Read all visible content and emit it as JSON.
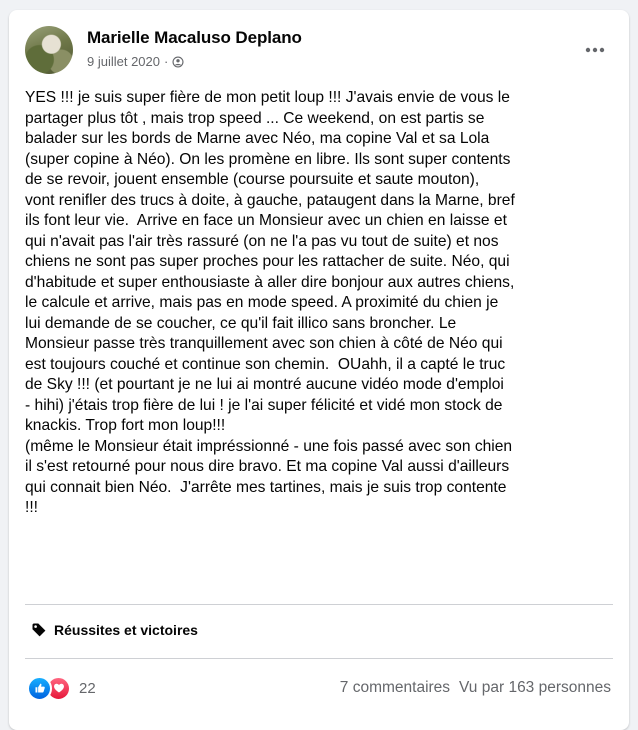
{
  "post": {
    "author": "Marielle Macaluso Deplano",
    "date": "9 juillet 2020",
    "separator": "·",
    "privacy_icon": "globe-icon",
    "more_icon": "more-horizontal-icon",
    "body": "YES !!! je suis super fière de mon petit loup !!! J'avais envie de vous le\npartager plus tôt , mais trop speed ... Ce weekend, on est partis se\nbalader sur les bords de Marne avec Néo, ma copine Val et sa Lola\n(super copine à Néo). On les promène en libre. Ils sont super contents\nde se revoir, jouent ensemble (course poursuite et saute mouton),\nvont renifler des trucs à doite, à gauche, pataugent dans la Marne, bref\nils font leur vie.  Arrive en face un Monsieur avec un chien en laisse et\nqui n'avait pas l'air très rassuré (on ne l'a pas vu tout de suite) et nos\nchiens ne sont pas super proches pour les rattacher de suite. Néo, qui\nd'habitude et super enthousiaste à aller dire bonjour aux autres chiens,\nle calcule et arrive, mais pas en mode speed. A proximité du chien je\nlui demande de se coucher, ce qu'il fait illico sans broncher. Le\nMonsieur passe très tranquillement avec son chien à côté de Néo qui\nest toujours couché et continue son chemin.  OUahh, il a capté le truc\nde Sky !!! (et pourtant je ne lui ai montré aucune vidéo mode d'emploi\n- hihi) j'étais trop fière de lui ! je l'ai super félicité et vidé mon stock de\nknackis. Trop fort mon loup!!!\n(même le Monsieur était impréssionné - une fois passé avec son chien\nil s'est retourné pour nous dire bravo. Et ma copine Val aussi d'ailleurs\nqui connait bien Néo.  J'arrête mes tartines, mais je suis trop contente\n!!!",
    "tag": {
      "icon": "tag-icon",
      "label": "Réussites et victoires"
    },
    "footer": {
      "reaction_icons": [
        "like-icon",
        "love-icon"
      ],
      "reaction_count": "22",
      "comments": "7 commentaires",
      "views": "Vu par 163 personnes"
    }
  },
  "colors": {
    "page_bg": "#f0f2f5",
    "secondary_text": "#65676b",
    "like_blue": "#1877f2",
    "love_red": "#f33e58"
  }
}
